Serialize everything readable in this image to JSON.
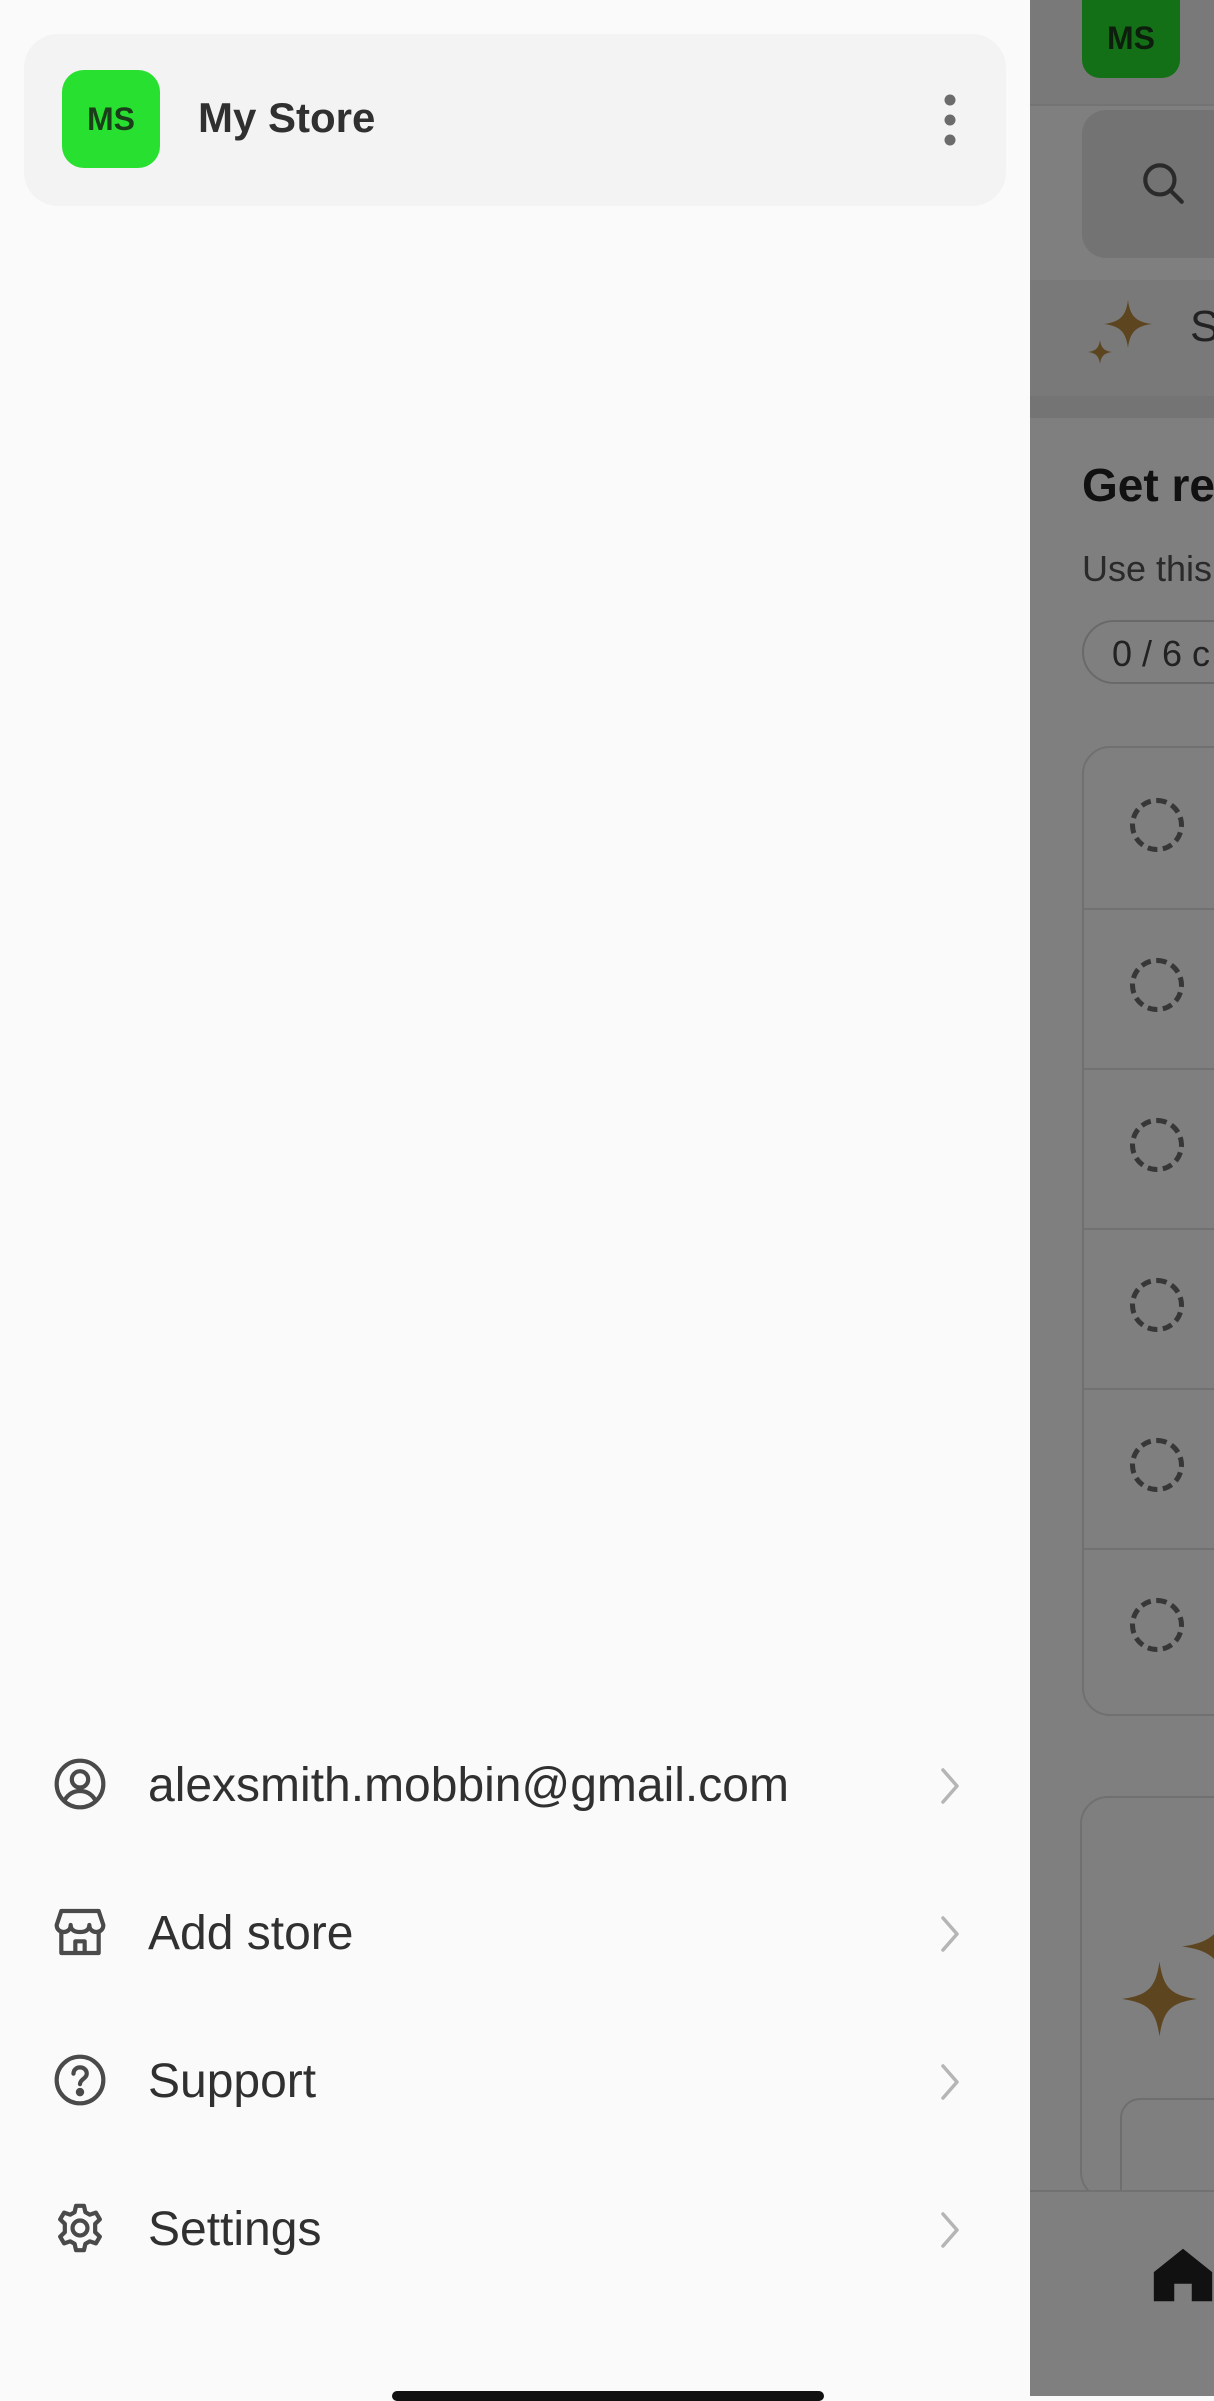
{
  "background_app": {
    "avatar_initials": "MS",
    "sparkle_row_text": "S",
    "heading": "Get re",
    "subtext": "Use this",
    "progress_pill": "0 / 6 c",
    "task_count": 6
  },
  "drawer": {
    "store": {
      "initials": "MS",
      "name": "My Store",
      "avatar_color": "#28e02f"
    },
    "menu": [
      {
        "label": "alexsmith.mobbin@gmail.com",
        "icon": "account-icon"
      },
      {
        "label": "Add store",
        "icon": "store-icon"
      },
      {
        "label": "Support",
        "icon": "help-icon"
      },
      {
        "label": "Settings",
        "icon": "gear-icon"
      }
    ]
  },
  "colors": {
    "accent_green": "#28e02f",
    "sparkle_gold": "#b88a3e",
    "text": "#303030"
  }
}
